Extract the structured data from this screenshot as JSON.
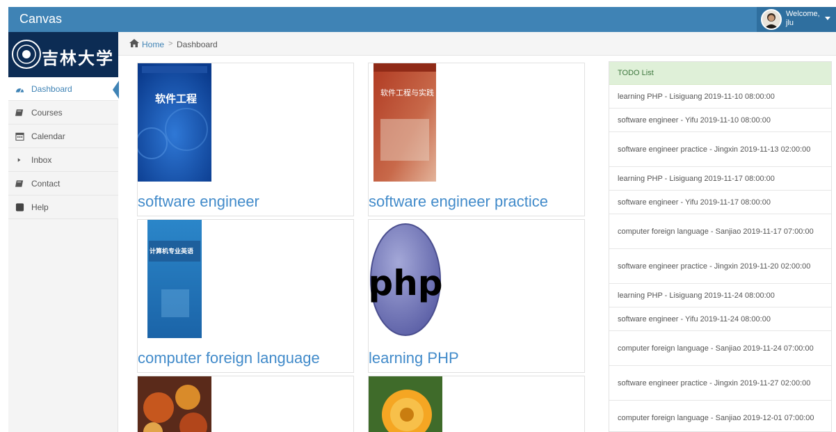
{
  "app": {
    "title": "Canvas"
  },
  "user": {
    "welcome": "Welcome,",
    "name": "jlu"
  },
  "sidebar": {
    "logo_text": "吉林大学",
    "items": [
      {
        "label": "Dashboard",
        "icon": "dashboard-icon"
      },
      {
        "label": "Courses",
        "icon": "book-icon"
      },
      {
        "label": "Calendar",
        "icon": "calendar-icon"
      },
      {
        "label": "Inbox",
        "icon": "caret-right-icon"
      },
      {
        "label": "Contact",
        "icon": "contact-icon"
      },
      {
        "label": "Help",
        "icon": "help-icon"
      }
    ]
  },
  "breadcrumb": {
    "home": "Home",
    "separator": ">",
    "current": "Dashboard"
  },
  "courses": [
    {
      "title": "software engineer",
      "cover_text": "软件工程"
    },
    {
      "title": "software engineer practice",
      "cover_text": "软件工程与实践"
    },
    {
      "title": "computer foreign language",
      "cover_text": "计算机专业英语"
    },
    {
      "title": "learning PHP",
      "cover_text": "php"
    }
  ],
  "todo": {
    "header": "TODO List",
    "items": [
      "learning PHP - Lisiguang   2019-11-10 08:00:00",
      "software engineer - Yifu   2019-11-10 08:00:00",
      "software engineer practice - Jingxin   2019-11-13 02:00:00",
      "learning PHP - Lisiguang   2019-11-17 08:00:00",
      "software engineer - Yifu   2019-11-17 08:00:00",
      "computer foreign language - Sanjiao   2019-11-17 07:00:00",
      "software engineer practice - Jingxin   2019-11-20 02:00:00",
      "learning PHP - Lisiguang   2019-11-24 08:00:00",
      "software engineer - Yifu   2019-11-24 08:00:00",
      "computer foreign language - Sanjiao   2019-11-24 07:00:00",
      "software engineer practice - Jingxin   2019-11-27 02:00:00",
      "computer foreign language - Sanjiao   2019-12-01 07:00:00"
    ]
  },
  "colors": {
    "topbar": "#3f83b5",
    "link": "#428bca",
    "todo_header": "#dff0d8"
  }
}
